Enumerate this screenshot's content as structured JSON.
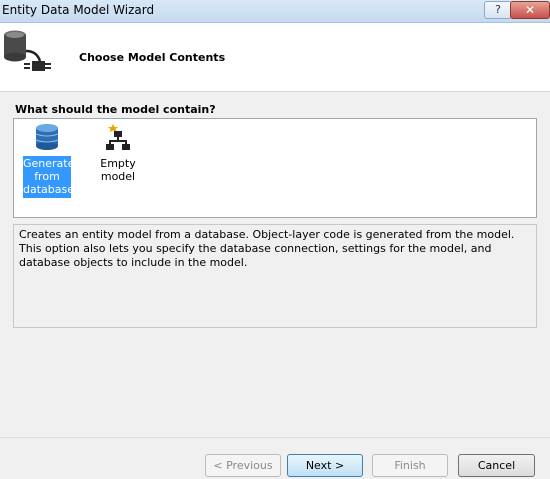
{
  "window": {
    "title": "Entity Data Model Wizard",
    "help_label": "?",
    "close_label": "✕"
  },
  "header": {
    "title": "Choose Model Contents",
    "icon": "database-plug-icon"
  },
  "section": {
    "label": "What should the model contain?"
  },
  "choices": [
    {
      "label": "Generate from database",
      "icon": "database-icon",
      "selected": true
    },
    {
      "label": "Empty model",
      "icon": "hierarchy-icon",
      "selected": false
    }
  ],
  "description": "Creates an entity model from a database. Object-layer code is generated from the model. This option also lets you specify the database connection, settings for the model, and database objects to include in the model.",
  "buttons": {
    "previous": "< Previous",
    "next": "Next >",
    "finish": "Finish",
    "cancel": "Cancel"
  },
  "colors": {
    "selection": "#3399ff",
    "titlebar": "#c5daf0",
    "close": "#c75050"
  }
}
